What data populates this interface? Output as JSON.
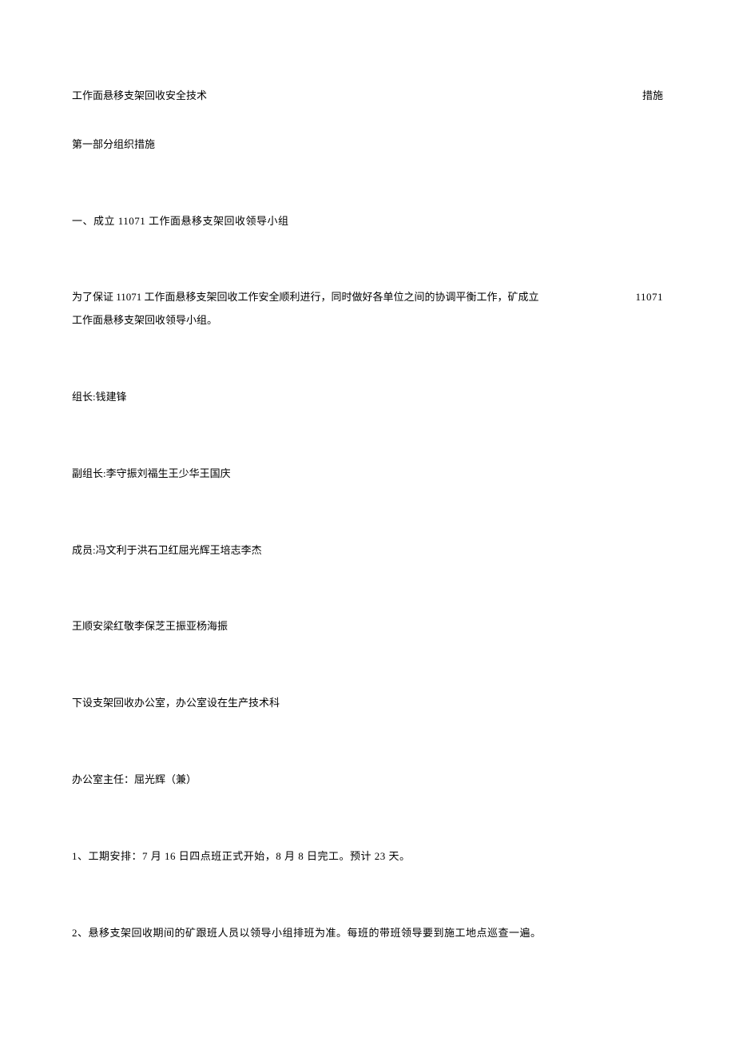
{
  "title": {
    "left": "工作面悬移支架回收安全技术",
    "right": "措施"
  },
  "section1_header": "第一部分组织措施",
  "section1_item1": "一、成立 11071 工作面悬移支架回收领导小组",
  "section1_para1_line1_left": "为了保证 11071 工作面悬移支架回收工作安全顺利进行，同时做好各单位之间的协调平衡工作，矿成立",
  "section1_para1_line1_right": "11071",
  "section1_para1_line2": "工作面悬移支架回收领导小组。",
  "group_leader": "组长:钱建锋",
  "deputy_leader": "副组长:李守振刘福生王少华王国庆",
  "members_line1": "成员:冯文利于洪石卫红屈光辉王培志李杰",
  "members_line2": "王顺安梁红敬李保芝王振亚杨海振",
  "office_setup": "下设支架回收办公室，办公室设在生产技术科",
  "office_director": "办公室主任：屈光辉（兼）",
  "schedule_item1": "1、工期安排：7 月 16 日四点班正式开始，8 月 8 日完工。预计 23 天。",
  "schedule_item2": "2、悬移支架回收期间的矿跟班人员以领导小组排班为准。每班的带班领导要到施工地点巡查一遍。"
}
